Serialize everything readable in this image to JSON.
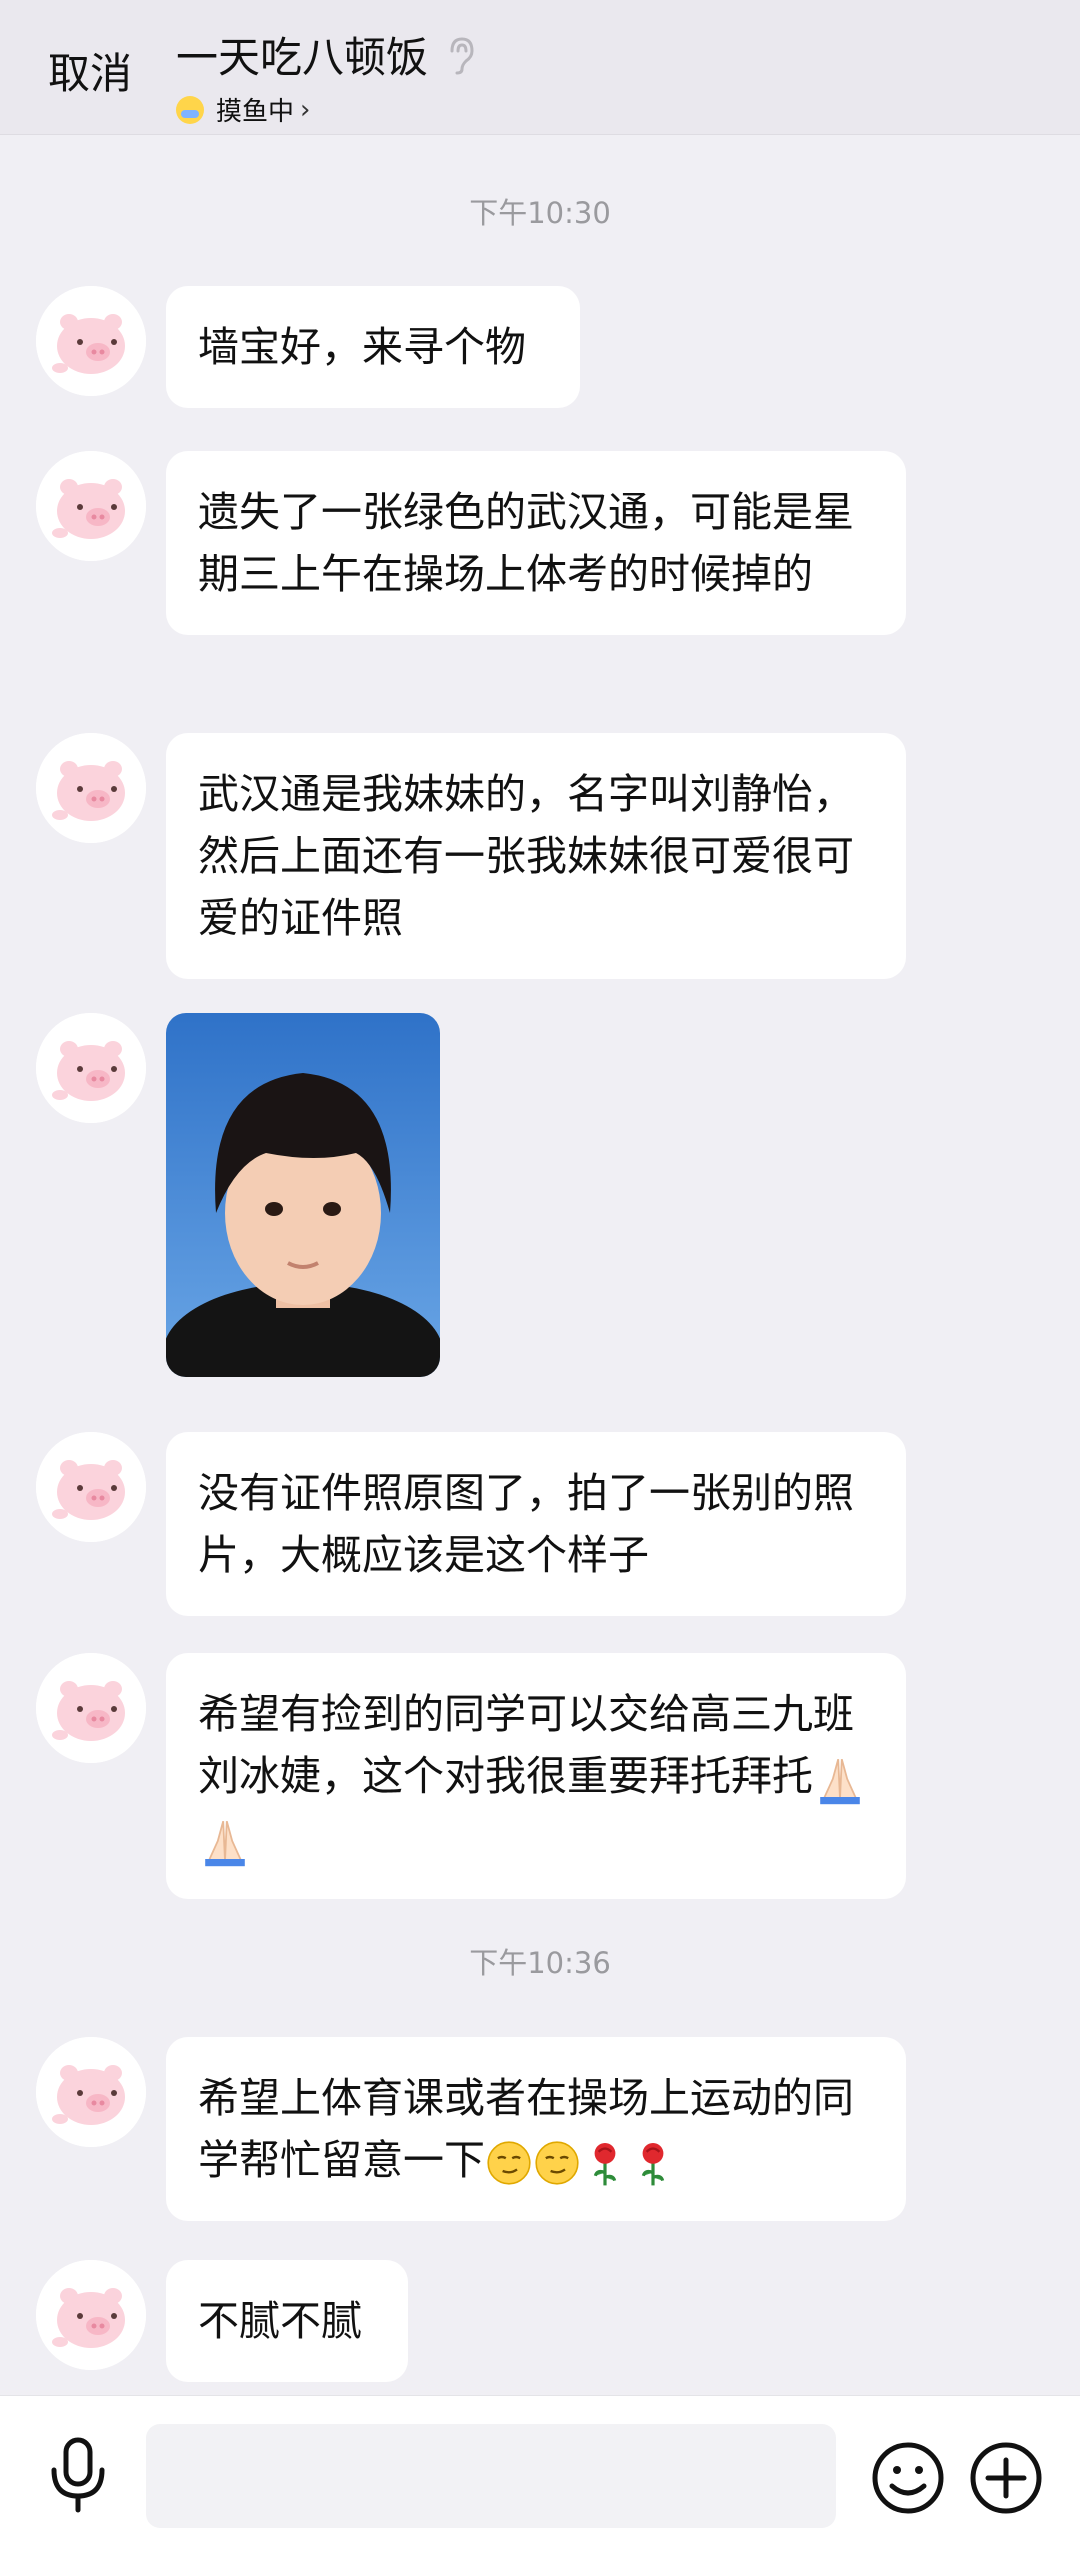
{
  "header": {
    "cancel_label": "取消",
    "title": "一天吃八顿饭",
    "status": "摸鱼中",
    "status_chevron": "›"
  },
  "timestamps": [
    "下午10:30",
    "下午10:36"
  ],
  "messages": [
    {
      "text": "墙宝好，来寻个物"
    },
    {
      "text": "遗失了一张绿色的武汉通，可能是星期三上午在操场上体考的时候掉的"
    },
    {
      "text": "武汉通是我妹妹的，名字叫刘静怡，然后上面还有一张我妹妹很可爱很可爱的证件照"
    },
    {
      "text": "没有证件照原图了，拍了一张别的照片，大概应该是这个样子"
    },
    {
      "text": "希望有捡到的同学可以交给高三九班刘冰婕，这个对我很重要拜托拜托"
    },
    {
      "text": "希望上体育课或者在操场上运动的同学帮忙留意一下"
    },
    {
      "text": "不腻不腻"
    }
  ],
  "photo": {
    "icon": "child-portrait-photo"
  },
  "emojis": {
    "m5": [
      "praying-hands",
      "praying-hands"
    ],
    "m6": [
      "smirk-face",
      "smirk-face",
      "rose",
      "rose"
    ]
  },
  "input": {
    "placeholder": "",
    "value": ""
  },
  "colors": {
    "background": "#f0eff4",
    "bubble": "#ffffff",
    "header": "#eae8ee",
    "timestamp": "#9a9a9e"
  }
}
